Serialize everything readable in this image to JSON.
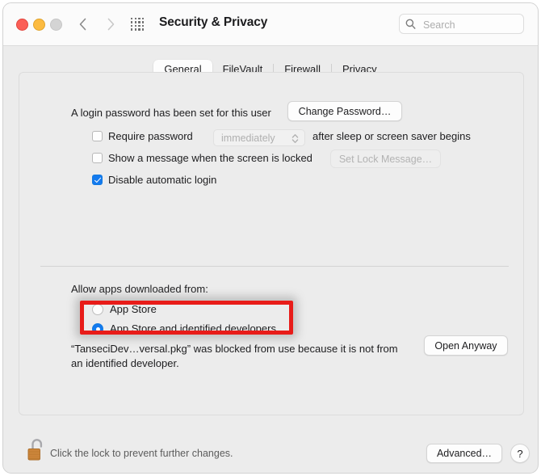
{
  "window": {
    "title": "Security & Privacy",
    "traffic_lights": [
      "close",
      "minimize",
      "maximize"
    ],
    "nav": {
      "back_icon": "chevron-left-icon",
      "forward_icon": "chevron-right-icon"
    },
    "grid_icon": "show-all-grid-icon"
  },
  "search": {
    "icon": "search-icon",
    "value": "",
    "placeholder": "Search"
  },
  "tabs": [
    {
      "label": "General",
      "selected": true
    },
    {
      "label": "FileVault",
      "selected": false
    },
    {
      "label": "Firewall",
      "selected": false
    },
    {
      "label": "Privacy",
      "selected": false
    }
  ],
  "general": {
    "login_password_text": "A login password has been set for this user",
    "change_password_button": "Change Password…",
    "require_password": {
      "label": "Require password",
      "checked": false,
      "popup_value": "immediately",
      "popup_enabled": false,
      "suffix": "after sleep or screen saver begins"
    },
    "show_message": {
      "label": "Show a message when the screen is locked",
      "checked": false,
      "button": "Set Lock Message…",
      "button_enabled": false
    },
    "disable_automatic_login": {
      "label": "Disable automatic login",
      "checked": true
    }
  },
  "allow_apps": {
    "heading": "Allow apps downloaded from:",
    "options": [
      {
        "label": "App Store",
        "selected": false
      },
      {
        "label": "App Store and identified developers",
        "selected": true
      }
    ],
    "blocked_message_line1": "“TanseciDev…versal.pkg” was blocked from use because it is not from",
    "blocked_message_line2": "an identified developer.",
    "open_anyway_button": "Open Anyway"
  },
  "annotation": {
    "shape": "red-highlight-rectangle",
    "color": "#e81c19"
  },
  "bottom": {
    "lock_icon": "unlocked-padlock-icon",
    "lock_text": "Click the lock to prevent further changes.",
    "advanced_button": "Advanced…",
    "help_button": "?"
  },
  "colors": {
    "accent": "#147aee",
    "annotation_red": "#e81c19",
    "window_bg": "#ececec",
    "titlebar_bg": "#fbfbfb"
  }
}
